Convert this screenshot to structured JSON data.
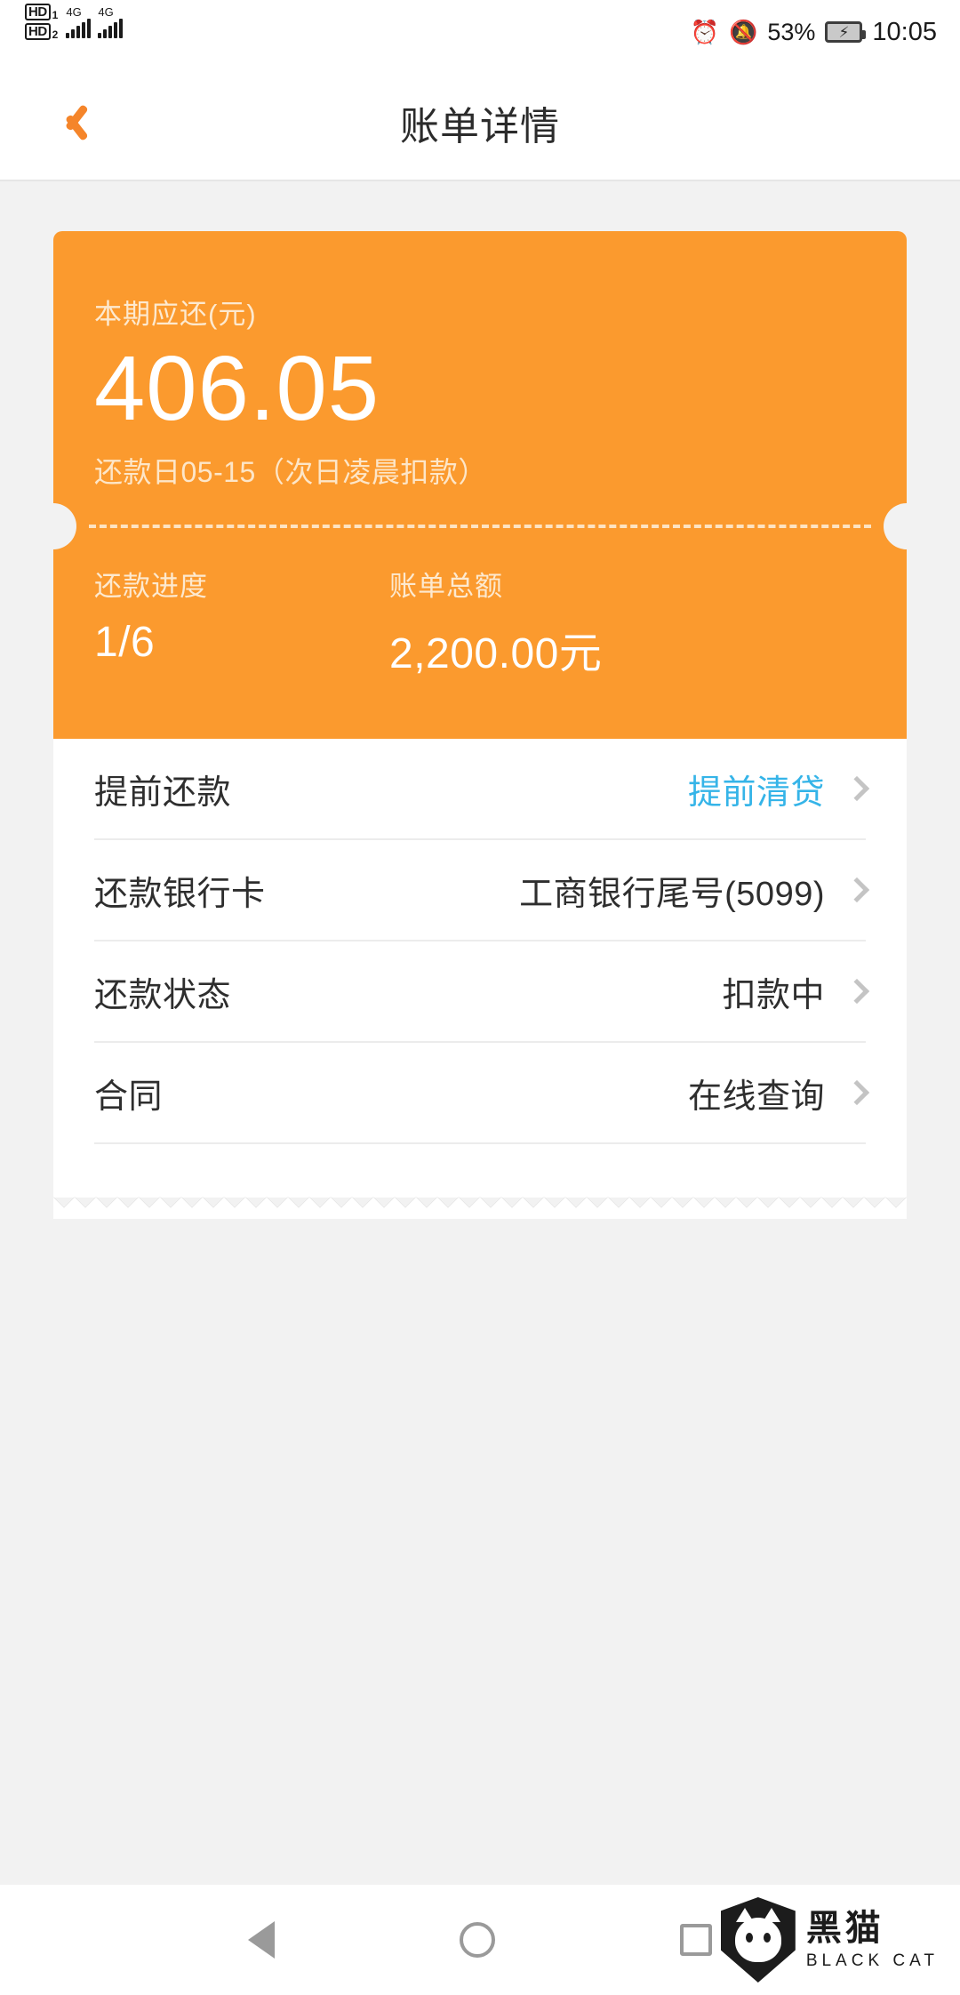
{
  "status_bar": {
    "sim1_hd": "HD",
    "sim1_index": "1",
    "sim2_hd": "HD",
    "sim2_index": "2",
    "network_1": "4G",
    "network_2": "4G",
    "alarm_icon": "⏰",
    "mute_icon": "🔕",
    "battery_percent": "53%",
    "battery_charging_icon": "⚡",
    "time": "10:05"
  },
  "header": {
    "back_icon": "chevron-left",
    "title": "账单详情"
  },
  "bill_card": {
    "due_label": "本期应还(元)",
    "due_amount": "406.05",
    "due_date_note": "还款日05-15（次日凌晨扣款）",
    "progress_label": "还款进度",
    "progress_value": "1/6",
    "total_label": "账单总额",
    "total_value": "2,200.00元",
    "accent_color": "#fb9a2e"
  },
  "detail_rows": [
    {
      "label": "提前还款",
      "value": "提前清贷",
      "accent": true,
      "chevron": "chevron-right"
    },
    {
      "label": "还款银行卡",
      "value": "工商银行尾号(5099)",
      "accent": false,
      "chevron": "chevron-right"
    },
    {
      "label": "还款状态",
      "value": "扣款中",
      "accent": false,
      "chevron": "chevron-right"
    },
    {
      "label": "合同",
      "value": "在线查询",
      "accent": false,
      "chevron": "chevron-right"
    }
  ],
  "nav_bar": {
    "back_label": "back-triangle",
    "home_label": "home-circle",
    "recent_label": "recents-square"
  },
  "watermark": {
    "cn": "黑猫",
    "en": "BLACK CAT"
  },
  "colors": {
    "accent_orange": "#fb9a2e",
    "link_blue": "#35b4e8",
    "page_bg": "#f2f2f2"
  }
}
